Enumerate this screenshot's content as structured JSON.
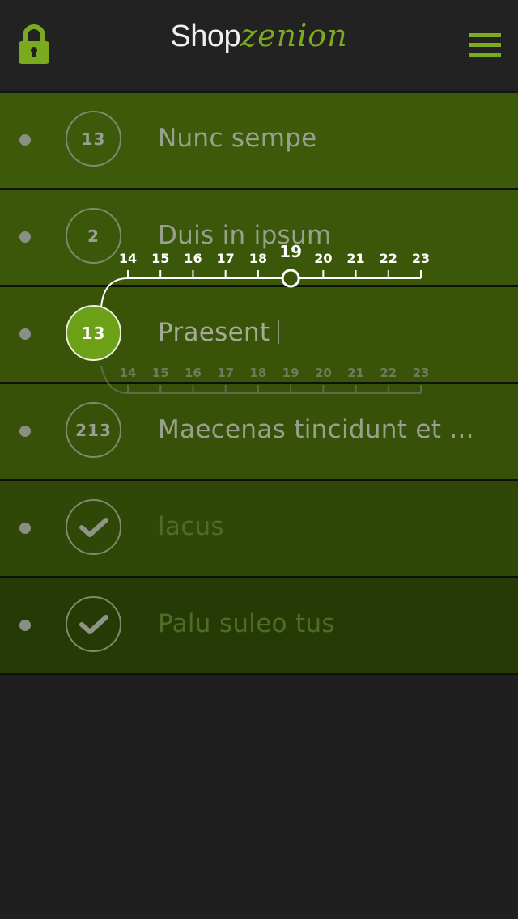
{
  "header": {
    "brand_main": "Shop",
    "brand_accent": "zenion",
    "lock_icon": "lock-icon",
    "menu_icon": "hamburger-menu-icon"
  },
  "colors": {
    "accent": "#7aab1e",
    "background": "#1f1f1f",
    "header": "#222222"
  },
  "rows": [
    {
      "badge": "13",
      "label": "Nunc sempe",
      "status": "open",
      "bg": "#3d5a0a"
    },
    {
      "badge": "2",
      "label": "Duis in ipsum",
      "status": "open",
      "bg": "#3b5709"
    },
    {
      "badge": "13",
      "label": "Praesent",
      "status": "editing",
      "bg": "#395409"
    },
    {
      "badge": "213",
      "label": "Maecenas tincidunt et ...",
      "status": "open",
      "bg": "#375109"
    },
    {
      "badge": "",
      "label": "lacus",
      "status": "done",
      "bg": "#2f4707"
    },
    {
      "badge": "",
      "label": "Palu suleo tus",
      "status": "done",
      "bg": "#253a05"
    }
  ],
  "time_slider": {
    "ticks": [
      "14",
      "15",
      "16",
      "17",
      "18",
      "19",
      "20",
      "21",
      "22",
      "23"
    ],
    "selected": "19"
  }
}
